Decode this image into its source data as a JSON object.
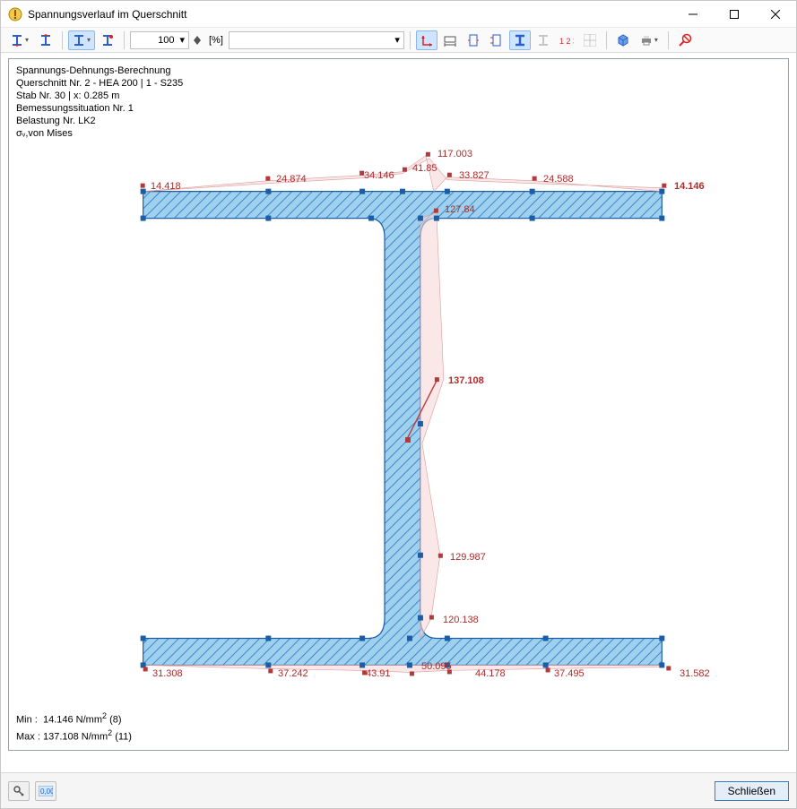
{
  "window": {
    "title": "Spannungsverlauf im Querschnitt"
  },
  "toolbar": {
    "zoom_value": "100",
    "unit_label": "[%]",
    "filter_value": ""
  },
  "meta": {
    "l1": "Spannungs-Dehnungs-Berechnung",
    "l2": "Querschnitt Nr. 2 - HEA 200 | 1 - S235",
    "l3": "Stab Nr. 30 | x: 0.285 m",
    "l4": "Bemessungssituation Nr. 1",
    "l5": "Belastung Nr. LK2",
    "sigma": "σᵥ,von Mises"
  },
  "summary": {
    "min_label": "Min :",
    "min_value": "14.146 N/mm",
    "min_suffix": "(8)",
    "max_label": "Max :",
    "max_value": "137.108 N/mm",
    "max_suffix": "(11)"
  },
  "footer": {
    "close_label": "Schließen"
  },
  "chart_data": {
    "type": "diagram",
    "description": "Von Mises stress distribution around an HEA 200 I-beam cross-section (top/bottom flanges + web). Each data point is a node on the section boundary with its stress in N/mm².",
    "section": "HEA 200",
    "units": "N/mm²",
    "max_point_index": 11,
    "min_point_index": 8,
    "points": [
      {
        "id": 1,
        "value": 14.418,
        "region": "top-flange-left-tip"
      },
      {
        "id": 2,
        "value": 24.874,
        "region": "top-flange"
      },
      {
        "id": 3,
        "value": 34.146,
        "region": "top-flange"
      },
      {
        "id": 4,
        "value": 41.85,
        "region": "top-flange-center-upper"
      },
      {
        "id": 5,
        "value": 117.003,
        "region": "top-flange-center-peak"
      },
      {
        "id": 6,
        "value": 33.827,
        "region": "top-flange"
      },
      {
        "id": 7,
        "value": 24.588,
        "region": "top-flange"
      },
      {
        "id": 8,
        "value": 14.146,
        "region": "top-flange-right-tip",
        "is_min": true
      },
      {
        "id": 9,
        "value": 127.84,
        "region": "web-top"
      },
      {
        "id": 10,
        "value": 137.108,
        "region": "web-mid",
        "is_max": true
      },
      {
        "id": 11,
        "value": 129.987,
        "region": "web-lower"
      },
      {
        "id": 12,
        "value": 120.138,
        "region": "web-bottom"
      },
      {
        "id": 13,
        "value": 31.308,
        "region": "bottom-flange-left-tip"
      },
      {
        "id": 14,
        "value": 37.242,
        "region": "bottom-flange"
      },
      {
        "id": 15,
        "value": 43.91,
        "region": "bottom-flange"
      },
      {
        "id": 16,
        "value": 50.095,
        "region": "bottom-flange-center"
      },
      {
        "id": 17,
        "value": 44.178,
        "region": "bottom-flange"
      },
      {
        "id": 18,
        "value": 37.495,
        "region": "bottom-flange"
      },
      {
        "id": 19,
        "value": 31.582,
        "region": "bottom-flange-right-tip"
      }
    ]
  },
  "icons": {
    "tool1": "i-section-down",
    "tool2": "i-section-up",
    "tool3": "i-section-left",
    "tool4": "i-section-right",
    "zoom_caret": "▾",
    "axis": "L-axis",
    "dim": "dimensions",
    "dim_h": "dim-horizontal",
    "dim_v": "dim-vertical",
    "profile": "i-profile",
    "profile_out": "i-profile-outline",
    "numbers": "numbers",
    "grid": "grid",
    "cube": "3d-cube",
    "print": "print",
    "cancel": "cancel",
    "key": "key-icon",
    "decimals": "decimals-icon"
  }
}
